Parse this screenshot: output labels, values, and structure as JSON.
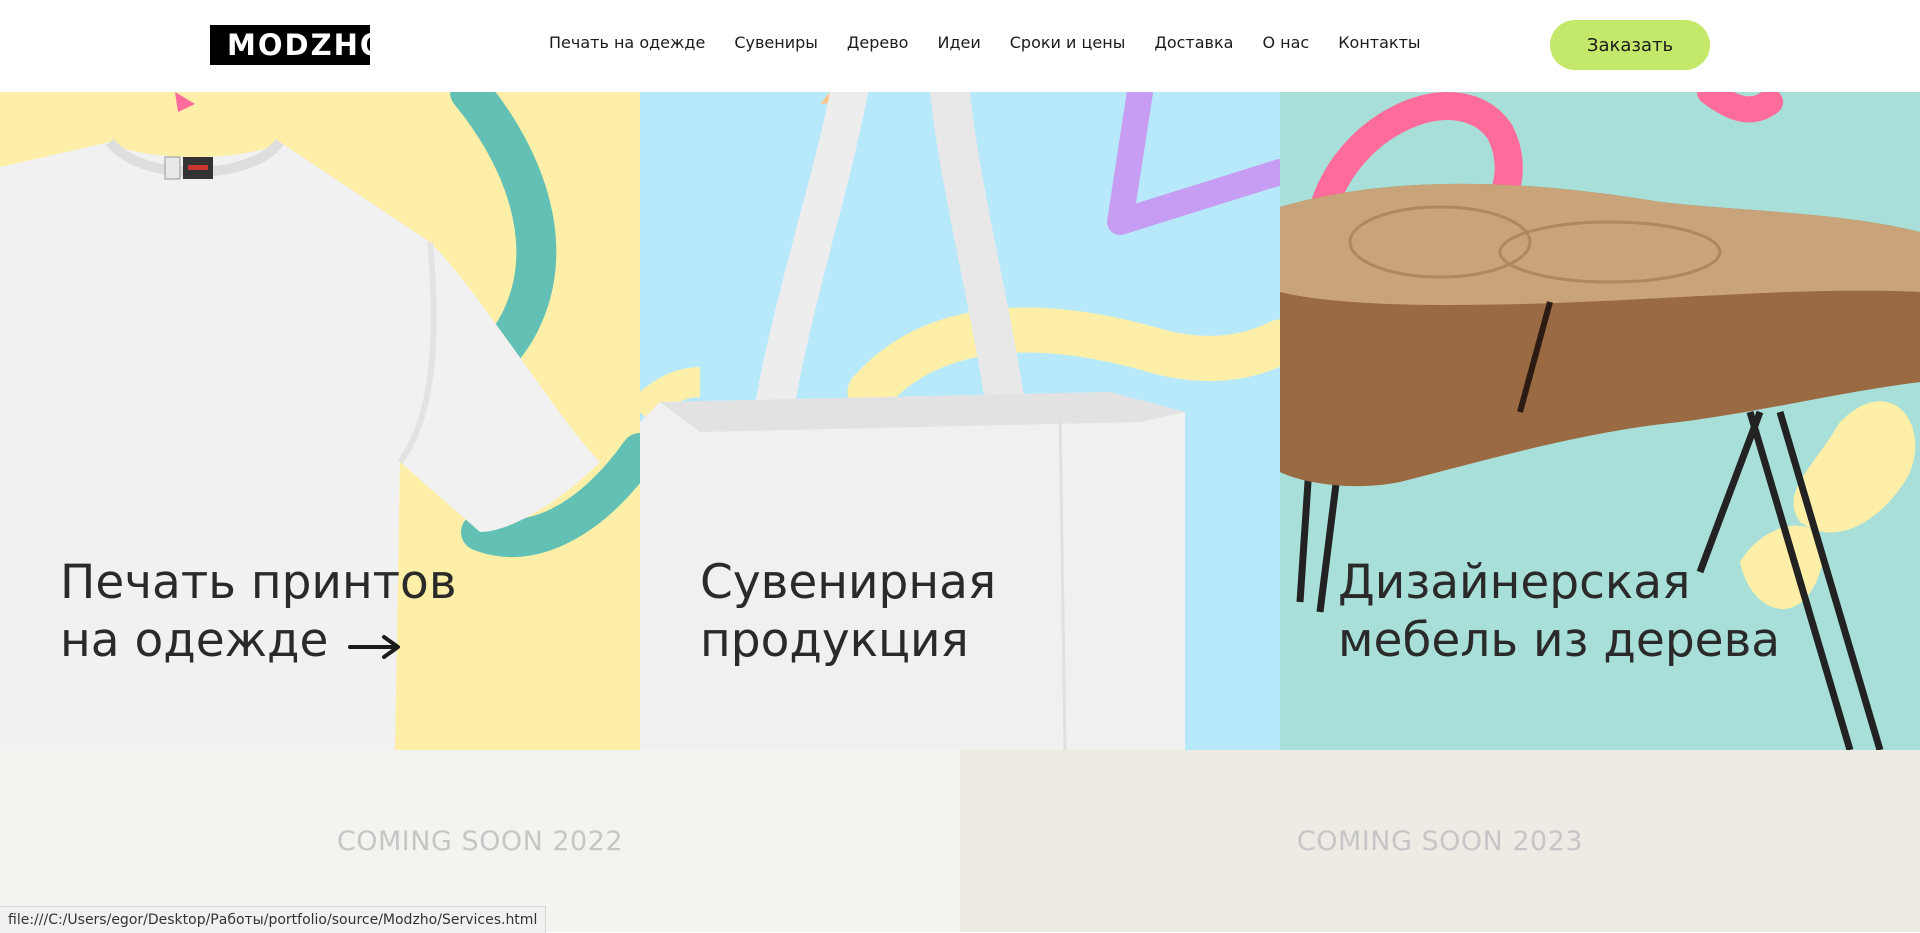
{
  "header": {
    "logo_text": "MODZHO",
    "nav": [
      "Печать на одежде",
      "Сувениры",
      "Дерево",
      "Идеи",
      "Сроки и цены",
      "Доставка",
      "О нас",
      "Контакты"
    ],
    "order_button": "Заказать",
    "accent_color": "#c3e86a"
  },
  "panels": [
    {
      "line1": "Печать принтов",
      "line2": "на одежде",
      "icon": "arrow-right-icon",
      "bg": "#fdefa8"
    },
    {
      "line1": "Сувенирная",
      "line2": "продукция",
      "bg": "#b8e9fb"
    },
    {
      "line1": "Дизайнерская",
      "line2": "мебель из дерева",
      "bg": "#a8dfd8"
    }
  ],
  "coming_soon": [
    "COMING SOON 2022",
    "COMING SOON 2023"
  ],
  "status_bar": "file:///C:/Users/egor/Desktop/Работы/portfolio/source/Modzho/Services.html"
}
